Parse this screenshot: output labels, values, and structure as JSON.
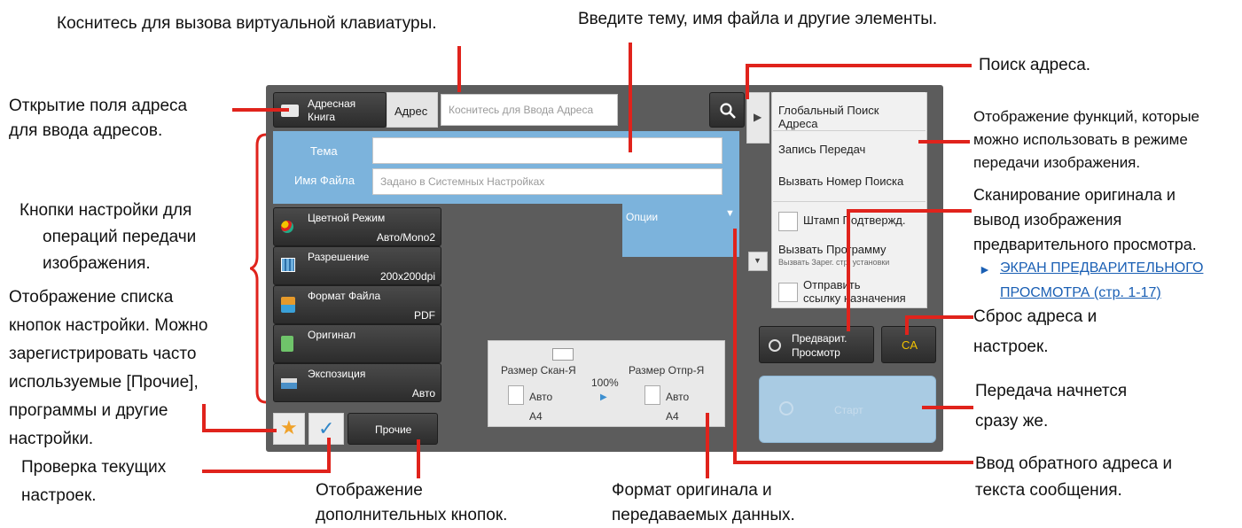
{
  "callouts": {
    "vkb": "Коснитесь для вызова виртуальной клавиатуры.",
    "enter_subject": "Введите тему, имя файла и другие элементы.",
    "addr_search": "Поиск адреса.",
    "open_addr_1": "Открытие поля адреса",
    "open_addr_2": "для ввода адресов.",
    "settings_btns_1": "Кнопки настройки для",
    "settings_btns_2": "операций передачи",
    "settings_btns_3": "изображения.",
    "list_1": "Отображение списка",
    "list_2": "кнопок настройки. Можно",
    "list_3": "зарегистрировать часто",
    "list_4": "используемые [Прочие],",
    "list_5": "программы и другие",
    "list_6": "настройки.",
    "check_1": "Проверка текущих",
    "check_2": "настроек.",
    "more_1": "Отображение",
    "more_2": "дополнительных кнопок.",
    "size_1": "Формат оригинала и",
    "size_2": "передаваемых данных.",
    "reply_1": "Ввод обратного адреса и",
    "reply_2": "текста сообщения.",
    "start_1": "Передача начнется",
    "start_2": "сразу же.",
    "reset_1": "Сброс адреса и",
    "reset_2": "настроек.",
    "scan_1": "Сканирование оригинала и",
    "scan_2": "вывод изображения",
    "scan_3": "предварительного просмотра.",
    "preview_link_1": "ЭКРАН ПРЕДВАРИТЕЛЬНОГО",
    "preview_link_2": "ПРОСМОТРА (стр. 1-17)",
    "funcs_1": "Отображение функций, которые",
    "funcs_2": "можно использовать в режиме",
    "funcs_3": "передачи изображения."
  },
  "screen": {
    "address_book_1": "Адресная",
    "address_book_2": "Книга",
    "address_label": "Адрес",
    "address_placeholder": "Коснитесь для Ввода Адреса",
    "subject_label": "Тема",
    "filename_label": "Имя Файла",
    "filename_placeholder": "Задано в Системных Настройках",
    "options_label": "Опции",
    "settings": [
      {
        "title": "Цветной Режим",
        "value": "Авто/Mono2"
      },
      {
        "title": "Разрешение",
        "value": "200x200dpi"
      },
      {
        "title": "Формат Файла",
        "value": "PDF"
      },
      {
        "title": "Оригинал",
        "value": ""
      },
      {
        "title": "Экспозиция",
        "value": "Авто"
      }
    ],
    "other_label": "Прочие",
    "scan_size_label": "Размер Скан-Я",
    "send_size_label": "Размер Отпр-Я",
    "ratio": "100%",
    "scan_auto": "Авто",
    "send_auto": "Авто",
    "scan_paper": "A4",
    "send_paper": "A4",
    "side_items": {
      "global_search": "Глобальный Поиск Адреса",
      "send_log": "Запись Передач",
      "call_search_no": "Вызвать Номер Поиска",
      "stamp": "Штамп Подтвержд.",
      "call_program": "Вызвать Программу",
      "call_program_sub": "Вызвать Зарег. стр. установки",
      "send_link_1": "Отправить",
      "send_link_2": "ссылку назначения"
    },
    "preview_1": "Предварит.",
    "preview_2": "Просмотр",
    "ca_label": "CA",
    "start_label": "Старт"
  },
  "colors": {
    "accent_blue": "#7cb3dc",
    "callout_red": "#e0231c",
    "ca_yellow": "#f2c200"
  }
}
